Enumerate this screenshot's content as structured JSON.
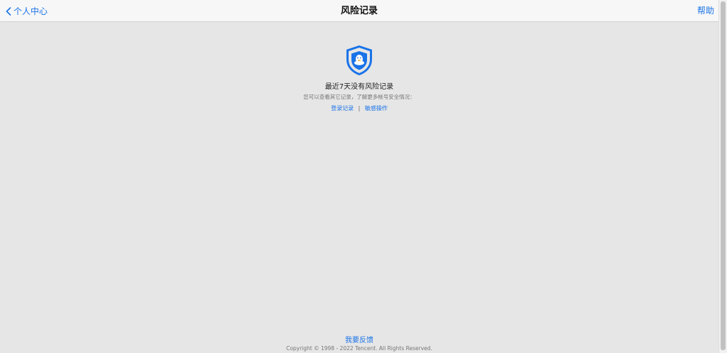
{
  "navbar": {
    "back_label": "个人中心",
    "title": "风险记录",
    "help_label": "帮助"
  },
  "main": {
    "icon": "qq-shield-icon",
    "headline": "最近7天没有风险记录",
    "description": "您可以查看其它记录，了解更多帐号安全情况：",
    "links": [
      {
        "label": "登录记录"
      },
      {
        "label": "敏感操作"
      }
    ],
    "separator": "|"
  },
  "footer": {
    "feedback_label": "我要反馈",
    "copyright": "Copyright © 1998 - 2022 Tencent. All Rights Reserved."
  },
  "colors": {
    "accent": "#1a73e8",
    "background": "#e6e6e6",
    "navbar": "#f7f7f7"
  }
}
